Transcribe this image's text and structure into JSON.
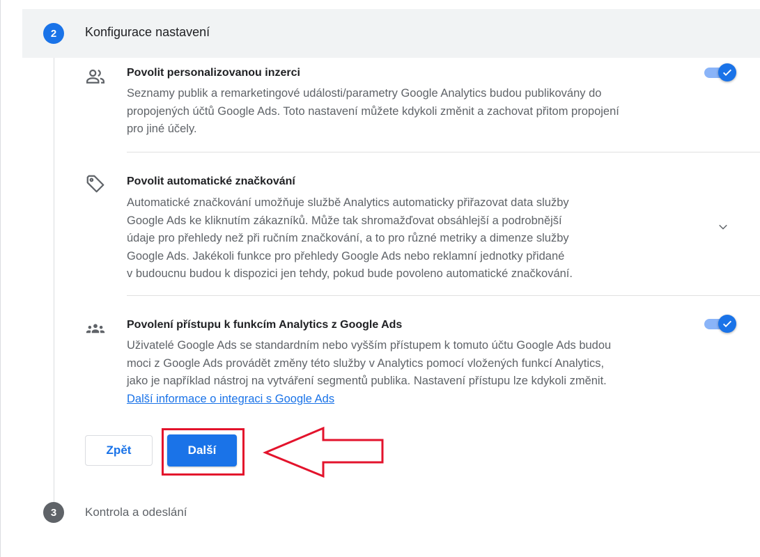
{
  "step2": {
    "number": "2",
    "title": "Konfigurace nastavení"
  },
  "settings": [
    {
      "icon": "people-icon",
      "title": "Povolit personalizovanou inzerci",
      "desc_lines": [
        "Seznamy publik a remarketingové události/parametry Google Analytics budou publikovány do",
        "propojených účtů Google Ads. Toto nastavení můžete kdykoli změnit a zachovat přitom propojení",
        "pro jiné účely."
      ],
      "toggle_on": true
    },
    {
      "icon": "tag-icon",
      "title": "Povolit automatické značkování",
      "desc_lines": [
        "Automatické značkování umožňuje službě Analytics automaticky přiřazovat data služby",
        "Google Ads ke kliknutím zákazníků. Může tak shromažďovat obsáhlejší a podrobnější",
        "údaje pro přehledy než při ručním značkování, a to pro různé metriky a dimenze služby",
        "Google Ads. Jakékoli funkce pro přehledy Google Ads nebo reklamní jednotky přidané",
        "v budoucnu budou k dispozici jen tehdy, pokud bude povoleno automatické značkování."
      ],
      "expandable": true
    },
    {
      "icon": "group-icon",
      "title": "Povolení přístupu k funkcím Analytics z Google Ads",
      "desc_lines": [
        "Uživatelé Google Ads se standardním nebo vyšším přístupem k tomuto účtu Google Ads budou",
        "moci z Google Ads provádět změny této služby v Analytics pomocí vložených funkcí Analytics,",
        "jako je například nástroj na vytváření segmentů publika. Nastavení přístupu lze kdykoli změnit."
      ],
      "link": "Další informace o integraci s Google Ads",
      "toggle_on": true
    }
  ],
  "buttons": {
    "back": "Zpět",
    "next": "Další"
  },
  "step3": {
    "number": "3",
    "title": "Kontrola a odeslání"
  },
  "colors": {
    "primary": "#1a73e8",
    "annotation": "#e3132c"
  }
}
